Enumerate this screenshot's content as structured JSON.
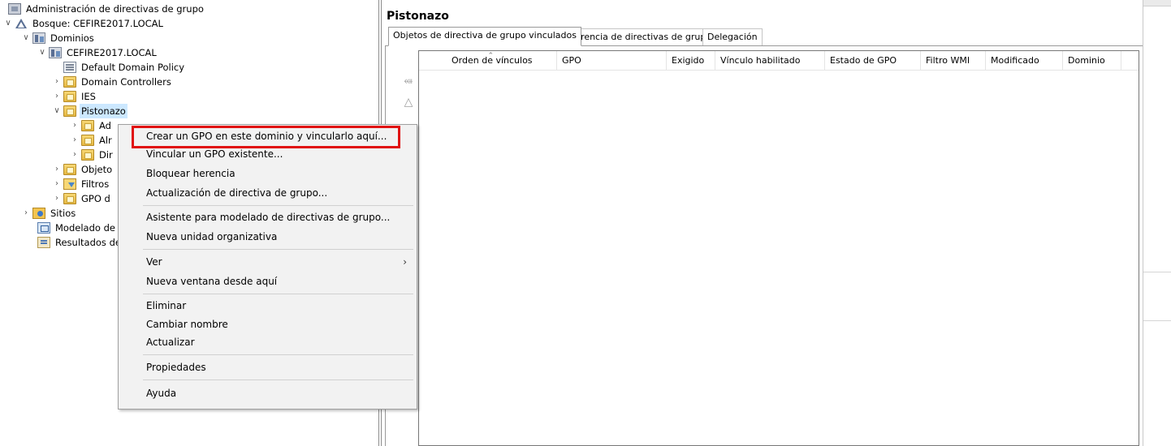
{
  "tree": {
    "root_label": "Administración de directivas de grupo",
    "forest_label": "Bosque: CEFIRE2017.LOCAL",
    "domains_label": "Dominios",
    "domain_label": "CEFIRE2017.LOCAL",
    "default_policy_label": "Default Domain Policy",
    "domain_controllers_label": "Domain Controllers",
    "ies_label": "IES",
    "pistonazo_label": "Pistonazo",
    "child1_label": "Ad",
    "child2_label": "Alr",
    "child3_label": "Dir",
    "objects_label": "Objeto",
    "filters_label": "Filtros",
    "starter_gpo_label": "GPO d",
    "sites_label": "Sitios",
    "modeling_label": "Modelado de",
    "results_label": "Resultados de"
  },
  "right_pane": {
    "title": "Pistonazo",
    "tabs": [
      {
        "label": "Objetos de directiva de grupo vinculados"
      },
      {
        "label": "Herencia de directivas de grupo"
      },
      {
        "label": "Delegación"
      }
    ],
    "columns": [
      "Orden de vínculos",
      "GPO",
      "Exigido",
      "Vínculo habilitado",
      "Estado de GPO",
      "Filtro WMI",
      "Modificado",
      "Dominio"
    ]
  },
  "context_menu": {
    "items": [
      {
        "label": "Crear un GPO en este dominio y vincularlo aquí..."
      },
      {
        "label": "Vincular un GPO existente..."
      },
      {
        "label": "Bloquear herencia"
      },
      {
        "label": "Actualización de directiva de grupo..."
      },
      {
        "label": "Asistente para modelado de directivas de grupo..."
      },
      {
        "label": "Nueva unidad organizativa"
      },
      {
        "label": "Ver"
      },
      {
        "label": "Nueva ventana desde aquí"
      },
      {
        "label": "Eliminar"
      },
      {
        "label": "Cambiar nombre"
      },
      {
        "label": "Actualizar"
      },
      {
        "label": "Propiedades"
      },
      {
        "label": "Ayuda"
      }
    ]
  },
  "colors": {
    "highlight_border": "#e01010",
    "selected_bg": "#cce8ff",
    "menu_bg": "#f2f2f2"
  }
}
